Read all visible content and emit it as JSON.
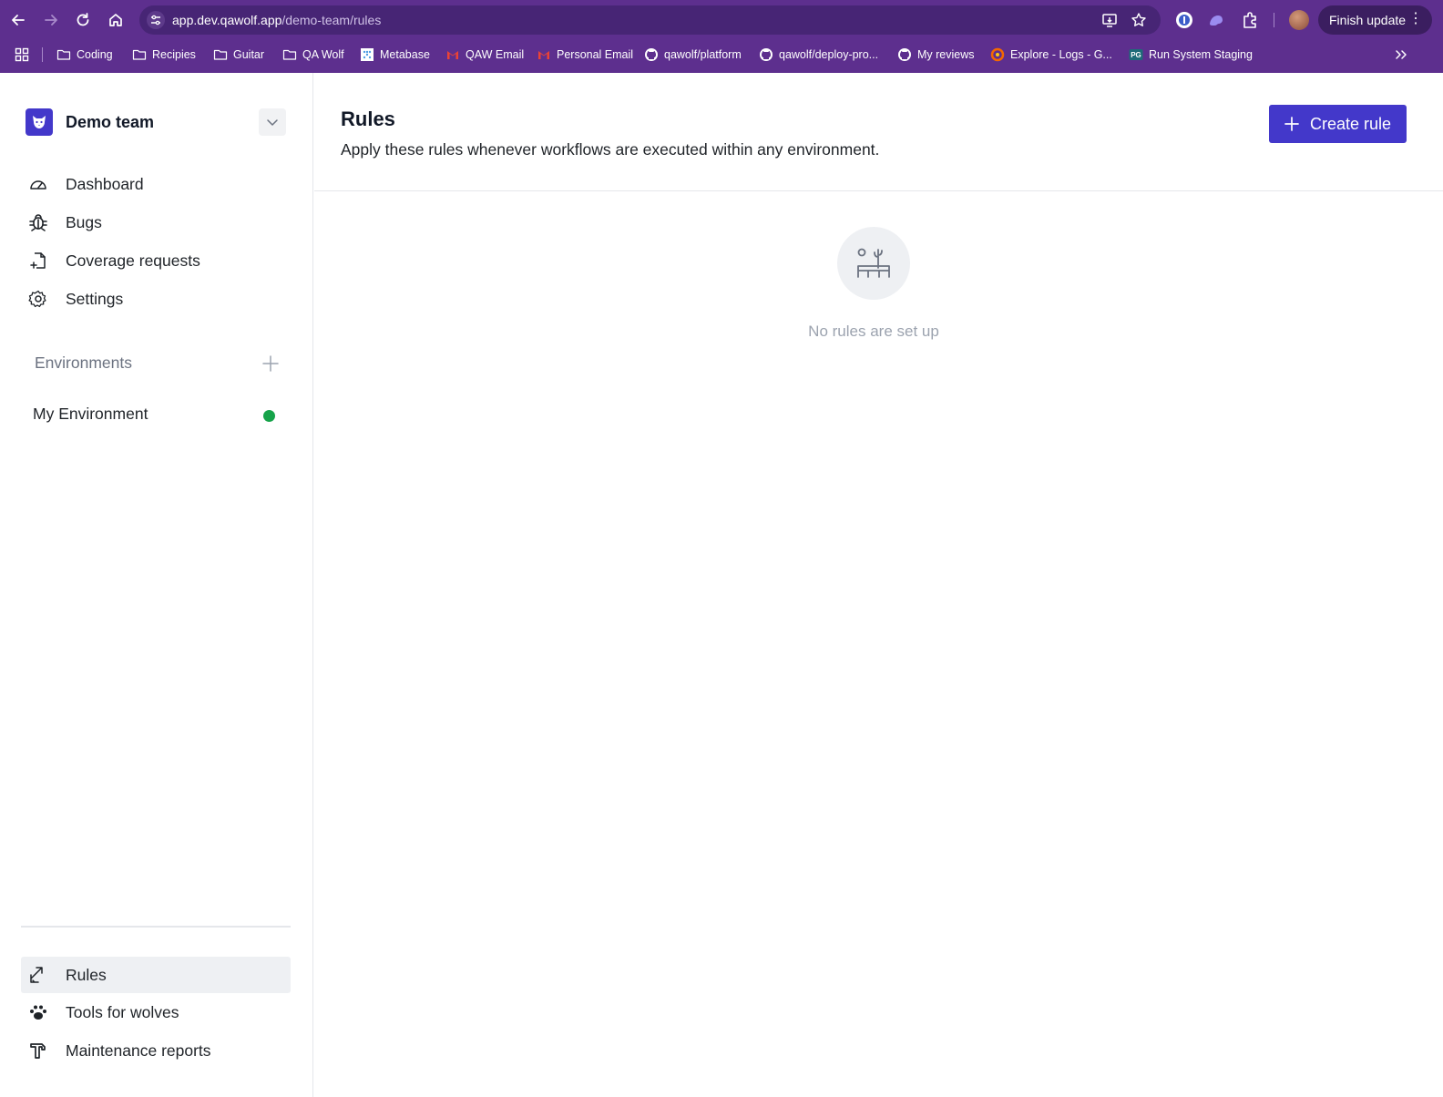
{
  "browser": {
    "url_host": "app.dev.qawolf.app",
    "url_path": "/demo-team/rules",
    "finish_update_label": "Finish update",
    "bookmarks": [
      {
        "label": "Coding",
        "icon": "folder-icon"
      },
      {
        "label": "Recipies",
        "icon": "folder-icon"
      },
      {
        "label": "Guitar",
        "icon": "folder-icon"
      },
      {
        "label": "QA Wolf",
        "icon": "folder-icon"
      },
      {
        "label": "Metabase",
        "icon": "metabase-icon"
      },
      {
        "label": "QAW Email",
        "icon": "gmail-icon"
      },
      {
        "label": "Personal Email",
        "icon": "gmail-icon"
      },
      {
        "label": "qawolf/platform",
        "icon": "github-icon"
      },
      {
        "label": "qawolf/deploy-pro...",
        "icon": "github-icon"
      },
      {
        "label": "My reviews",
        "icon": "github-icon"
      },
      {
        "label": "Explore - Logs - G...",
        "icon": "grafana-icon"
      },
      {
        "label": "Run System Staging",
        "icon": "pg-icon"
      }
    ]
  },
  "sidebar": {
    "team_name": "Demo team",
    "nav": [
      {
        "label": "Dashboard",
        "icon": "gauge-icon"
      },
      {
        "label": "Bugs",
        "icon": "bug-icon"
      },
      {
        "label": "Coverage requests",
        "icon": "file-plus-icon"
      },
      {
        "label": "Settings",
        "icon": "gear-icon"
      }
    ],
    "environments_heading": "Environments",
    "environments": [
      {
        "label": "My Environment",
        "status_color": "#16a34a"
      }
    ],
    "bottom_nav": [
      {
        "label": "Rules",
        "icon": "rules-icon",
        "active": true
      },
      {
        "label": "Tools for wolves",
        "icon": "paw-icon"
      },
      {
        "label": "Maintenance reports",
        "icon": "hammer-icon"
      }
    ]
  },
  "main": {
    "title": "Rules",
    "subtitle": "Apply these rules whenever workflows are executed within any environment.",
    "create_button_label": "Create rule",
    "empty_state_text": "No rules are set up"
  },
  "colors": {
    "chrome": "#5d2f8e",
    "accent": "#4338ca",
    "status_ok": "#16a34a"
  }
}
